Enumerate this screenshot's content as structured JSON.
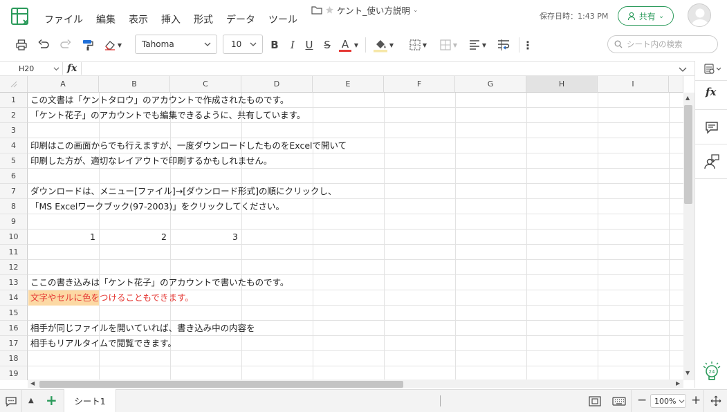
{
  "menu": [
    "ファイル",
    "編集",
    "表示",
    "挿入",
    "形式",
    "データ",
    "ツール"
  ],
  "doc": {
    "title": "ケント_使い方説明"
  },
  "save_status": "保存日時：1:43 PM",
  "share_label": "共有",
  "toolbar": {
    "font": "Tahoma",
    "size": "10",
    "bold": "B",
    "italic": "I",
    "underline": "U",
    "strike": "S",
    "color_letter": "A"
  },
  "search": {
    "placeholder": "シート内の検索"
  },
  "namebox": "H20",
  "fx": "fx",
  "columns": [
    "A",
    "B",
    "C",
    "D",
    "E",
    "F",
    "G",
    "H",
    "I"
  ],
  "selected_column": "H",
  "rows": [
    "1",
    "2",
    "3",
    "4",
    "5",
    "6",
    "7",
    "8",
    "9",
    "10",
    "11",
    "12",
    "13",
    "14",
    "15",
    "16",
    "17",
    "18",
    "19"
  ],
  "cells": {
    "r1": "この文書は「ケントタロウ」のアカウントで作成されたものです。",
    "r2": "「ケント花子」のアカウントでも編集できるように、共有しています。",
    "r4": "印刷はこの画面からでも行えますが、一度ダウンロードしたものをExcelで開いて",
    "r5": "印刷した方が、適切なレイアウトで印刷するかもしれません。",
    "r7": "ダウンロードは、メニュー[ファイル]→[ダウンロード形式]の順にクリックし、",
    "r8": "「MS Excelワークブック(97-2003)」をクリックしてください。",
    "r10a": "1",
    "r10b": "2",
    "r10c": "3",
    "r13": "ここの書き込みは「ケント花子」のアカウントで書いたものです。",
    "r14": "文字やセルに色をつけることもできます。",
    "r16": "相手が同じファイルを開いていれば、書き込み中の内容を",
    "r17": "相手もリアルタイムで閲覧できます。"
  },
  "colors": {
    "accent": "#2a9a5a",
    "highlight_cell": "#fcd9a4",
    "red_text": "#e53935"
  },
  "sheet_tab": "シート1",
  "zoom": "100%"
}
